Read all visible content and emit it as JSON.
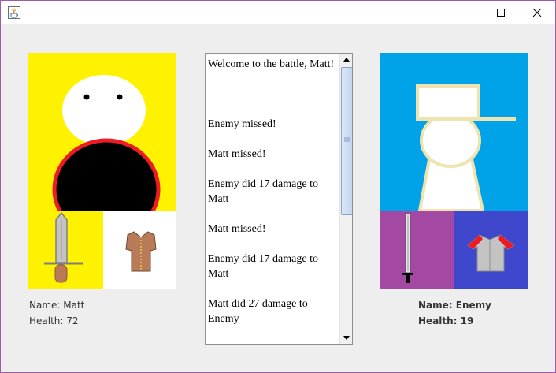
{
  "window": {
    "icon": "java-coffee-icon",
    "controls": [
      "minimize-icon",
      "maximize-icon",
      "close-icon"
    ]
  },
  "player": {
    "name_text": "Name: Matt",
    "health_text": "Health: 72"
  },
  "enemy": {
    "name_text": "Name: Enemy",
    "health_text": "Health: 19"
  },
  "battle_log": {
    "entries": [
      "Welcome to the battle, Matt!",
      "Enemy missed!",
      "Matt missed!",
      "Enemy did 17 damage to Matt",
      "Matt missed!",
      "Enemy did 17 damage to Matt",
      "Matt did 27 damage to Enemy"
    ]
  },
  "colors": {
    "player_bg": "#fff200",
    "enemy_bg": "#00a2e8",
    "enemy_weapon_bg": "#a349a4",
    "enemy_armor_bg": "#3f48cc",
    "mouth_ring": "#ed1c24"
  }
}
